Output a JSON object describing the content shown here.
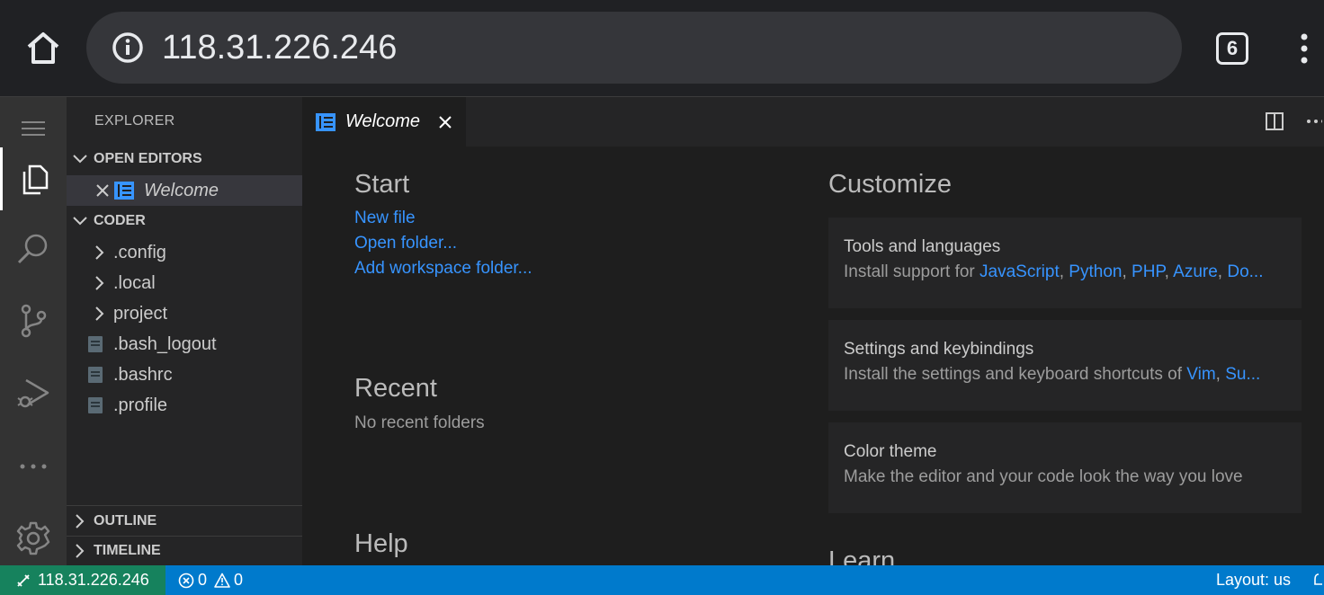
{
  "browser": {
    "url": "118.31.226.246",
    "tab_count": "6"
  },
  "sidebar": {
    "title": "EXPLORER",
    "open_editors_label": "OPEN EDITORS",
    "open_editors": [
      {
        "label": "Welcome"
      }
    ],
    "workspace_label": "CODER",
    "tree": [
      {
        "label": ".config",
        "type": "folder"
      },
      {
        "label": ".local",
        "type": "folder"
      },
      {
        "label": "project",
        "type": "folder"
      },
      {
        "label": ".bash_logout",
        "type": "file"
      },
      {
        "label": ".bashrc",
        "type": "file"
      },
      {
        "label": ".profile",
        "type": "file"
      }
    ],
    "outline_label": "OUTLINE",
    "timeline_label": "TIMELINE"
  },
  "editor": {
    "tab_label": "Welcome"
  },
  "welcome": {
    "start_title": "Start",
    "start_links": [
      "New file",
      "Open folder...",
      "Add workspace folder..."
    ],
    "recent_title": "Recent",
    "recent_empty": "No recent folders",
    "help_title": "Help",
    "customize_title": "Customize",
    "learn_title": "Learn",
    "cards": [
      {
        "title": "Tools and languages",
        "prefix": "Install support for ",
        "links": [
          "JavaScript",
          "Python",
          "PHP",
          "Azure",
          "Do..."
        ]
      },
      {
        "title": "Settings and keybindings",
        "prefix": "Install the settings and keyboard shortcuts of ",
        "links": [
          "Vim",
          "Su..."
        ]
      },
      {
        "title": "Color theme",
        "prefix": "Make the editor and your code look the way you love",
        "links": []
      }
    ]
  },
  "status": {
    "remote": "118.31.226.246",
    "errors": "0",
    "warnings": "0",
    "layout": "Layout: us"
  },
  "colors": {
    "accent": "#007acc",
    "remote": "#16825d",
    "link": "#3794ff"
  },
  "icons": [
    "home-icon",
    "info-icon",
    "menu-icon",
    "explorer-icon",
    "search-icon",
    "source-control-icon",
    "run-debug-icon",
    "more-icon",
    "gear-icon",
    "welcome-icon",
    "close-icon",
    "split-editor-icon",
    "remote-icon",
    "error-icon",
    "warning-icon",
    "bell-icon"
  ]
}
